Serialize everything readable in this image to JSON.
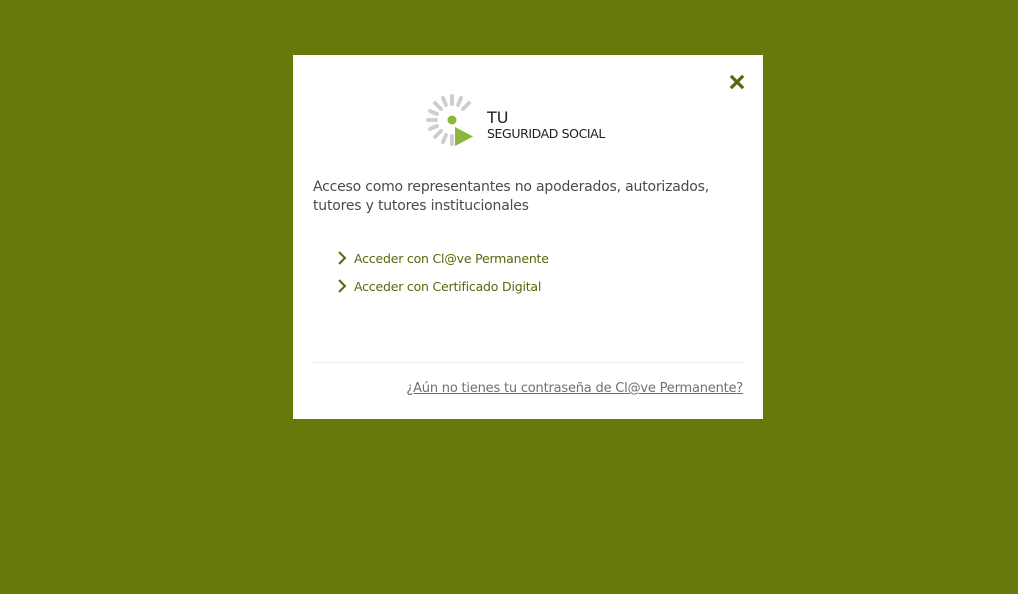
{
  "colors": {
    "background": "#657a0b",
    "accent": "#55690b",
    "logo_green": "#8bb83a",
    "logo_gray": "#cfcfcf"
  },
  "modal": {
    "close_icon": "close-x-icon",
    "logo": {
      "icon": "tu-seguridad-social-logo-icon",
      "line1": "TU",
      "line2": "SEGURIDAD SOCIAL"
    },
    "heading": "Acceso como representantes no apoderados, autorizados, tutores y tutores institucionales",
    "options": [
      {
        "icon": "chevron-right-icon",
        "label": "Acceder con Cl@ve Permanente"
      },
      {
        "icon": "chevron-right-icon",
        "label": "Acceder con Certificado Digital"
      }
    ],
    "footer_link": "¿Aún no tienes tu contraseña de Cl@ve Permanente?"
  }
}
